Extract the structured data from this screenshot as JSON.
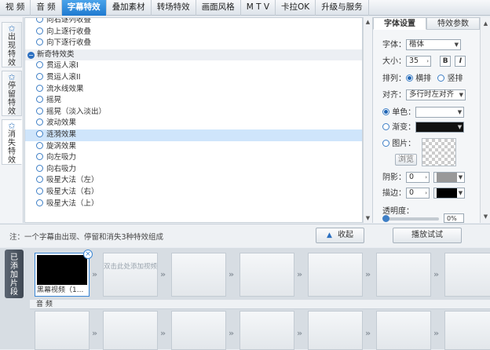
{
  "tabs": [
    "视 频",
    "音 频",
    "字幕特效",
    "叠加素材",
    "转场特效",
    "画面风格",
    "M T V",
    "卡拉OK",
    "升级与服务"
  ],
  "active_tab": "字幕特效",
  "vtabs": [
    {
      "label": "出现特效",
      "icon": "star-icon"
    },
    {
      "label": "停留特效",
      "icon": "star-icon"
    },
    {
      "label": "消失特效",
      "icon": "star-icon"
    }
  ],
  "effects": {
    "pre_items": [
      "向右逐列收叠",
      "向上逐行收叠",
      "向下逐行收叠"
    ],
    "category": "新奇特效类",
    "items": [
      "贯运人滚I",
      "贯运人滚II",
      "流水线效果",
      "摇晃",
      "摇晃（淡入淡出）",
      "波动效果",
      "涟漪效果",
      "旋涡效果",
      "向左吸力",
      "向右吸力",
      "吸星大法（左）",
      "吸星大法（右）",
      "吸星大法（上）"
    ],
    "selected": "涟漪效果"
  },
  "right_panel": {
    "tabs": [
      "字体设置",
      "特效参数"
    ],
    "font_label": "字体：",
    "font_value": "楷体",
    "size_label": "大小：",
    "size_value": "35",
    "bold": "B",
    "italic": "I",
    "layout_label": "排列：",
    "layout_h": "横排",
    "layout_v": "竖排",
    "align_label": "对齐：",
    "align_value": "多行时左对齐",
    "single_color": "单色：",
    "gradient": "渐变：",
    "image": "图片：",
    "browse": "浏览",
    "shadow_label": "阴影：",
    "shadow_value": "0",
    "stroke_label": "描边：",
    "stroke_value": "0",
    "opacity_label": "透明度：",
    "opacity_value": "0%"
  },
  "note": "注：一个字幕由出现、停留和消失3种特效组成",
  "collapse_button": "收起",
  "play_button": "播放试试",
  "timeline": {
    "added_label": "已添加片段",
    "first_clip": "黑幕视频（1...",
    "placeholder": "双击此处添加视频",
    "audio_label": "音 频"
  },
  "colors": {
    "accent": "#1f7ad0",
    "selected_row": "#cfe5fb"
  }
}
